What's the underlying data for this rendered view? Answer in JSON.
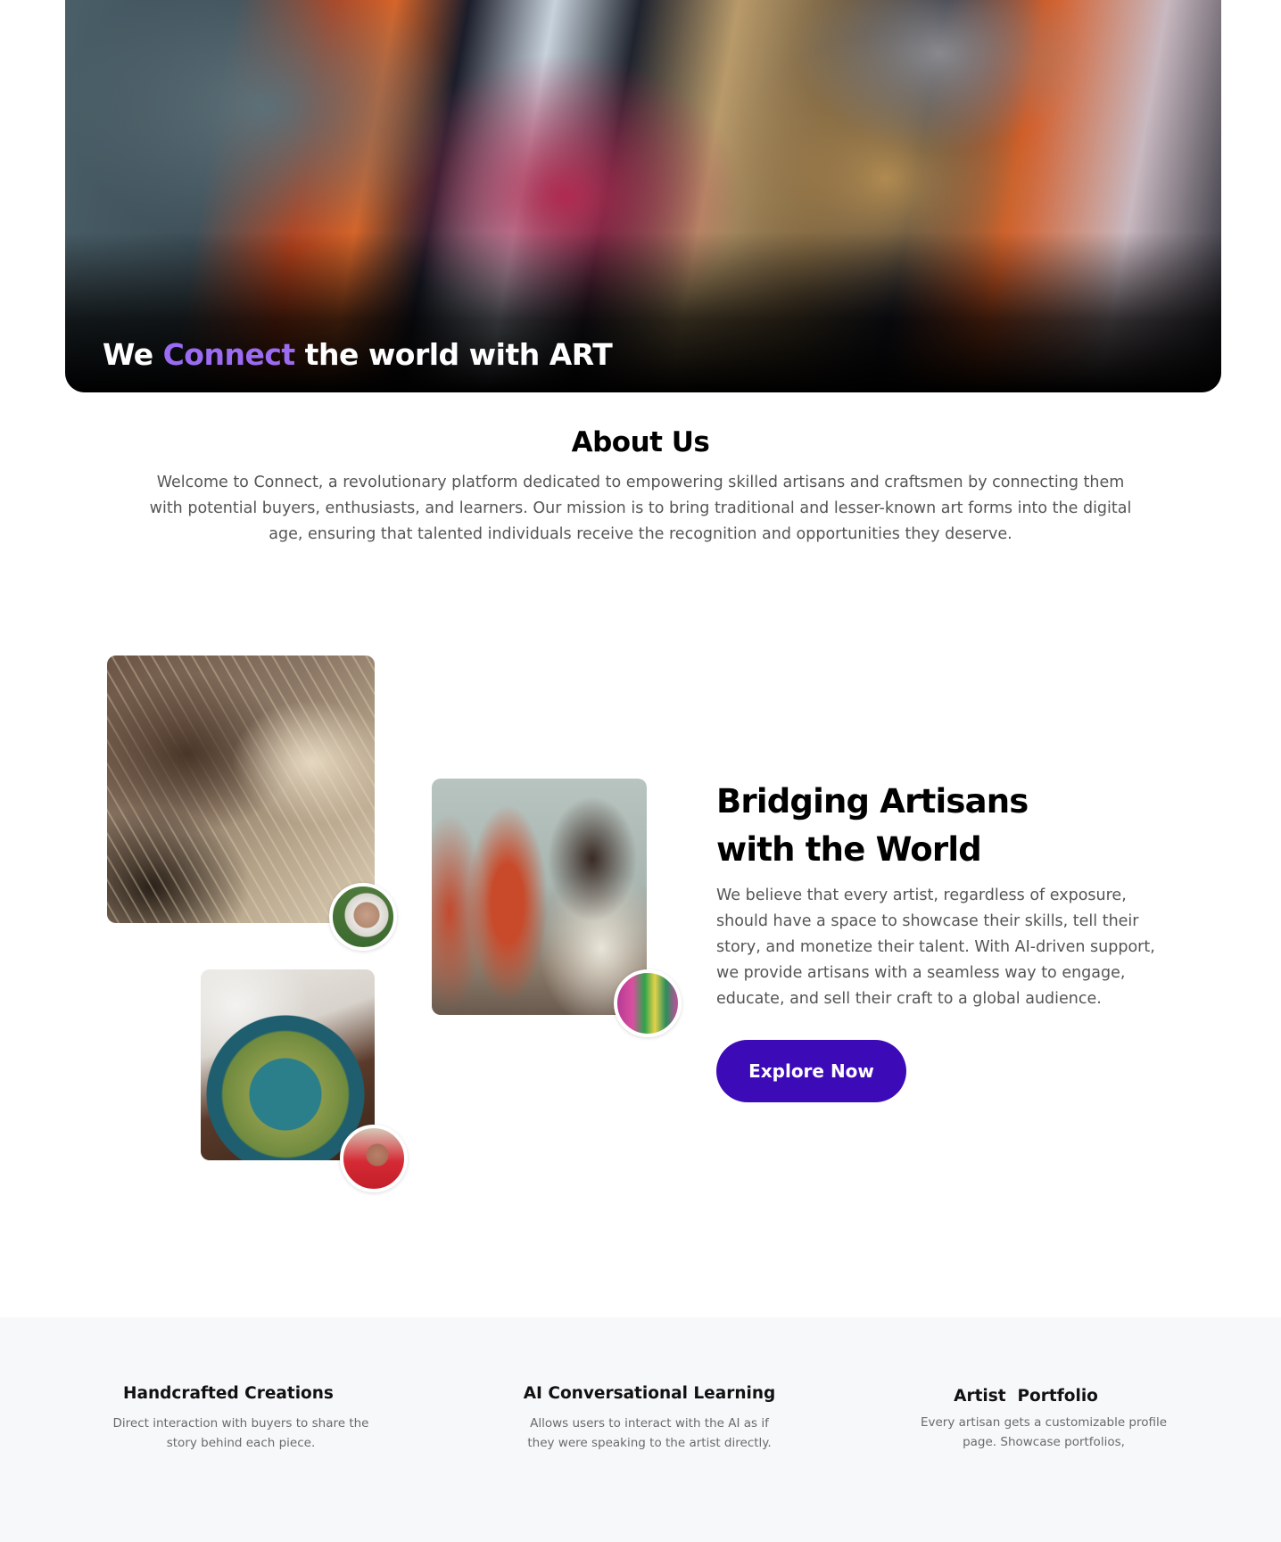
{
  "hero": {
    "title_before": "We ",
    "title_accent": "Connect",
    "title_after": " the world with ART",
    "accent_color": "#9b6bf2"
  },
  "about": {
    "title": "About Us",
    "text": "Welcome to Connect, a revolutionary platform dedicated to empowering skilled artisans and craftsmen by connecting them with potential buyers, enthusiasts, and learners. Our mission is to bring traditional and lesser-known art forms into the digital age, ensuring that talented individuals receive the recognition and opportunities they deserve."
  },
  "bridge": {
    "title_line1": "Bridging Artisans",
    "title_line2": "with the World",
    "text": "We believe that every artist, regardless of exposure, should have a space to showcase their skills, tell their story, and monetize their talent. With AI-driven support, we provide artisans with a seamless way to engage, educate, and sell their craft to a global audience.",
    "button_label": "Explore Now",
    "button_color": "#3d0ab8"
  },
  "features": [
    {
      "title": "Handcrafted Creations",
      "text": "Direct interaction with buyers to share the story behind each piece."
    },
    {
      "title": "AI Conversational Learning",
      "text": "Allows users to interact with the AI as if they were speaking to the artist directly."
    },
    {
      "title": "Artist  Portfolio",
      "text": "Every artisan gets a customizable profile page. Showcase portfolios,"
    }
  ]
}
